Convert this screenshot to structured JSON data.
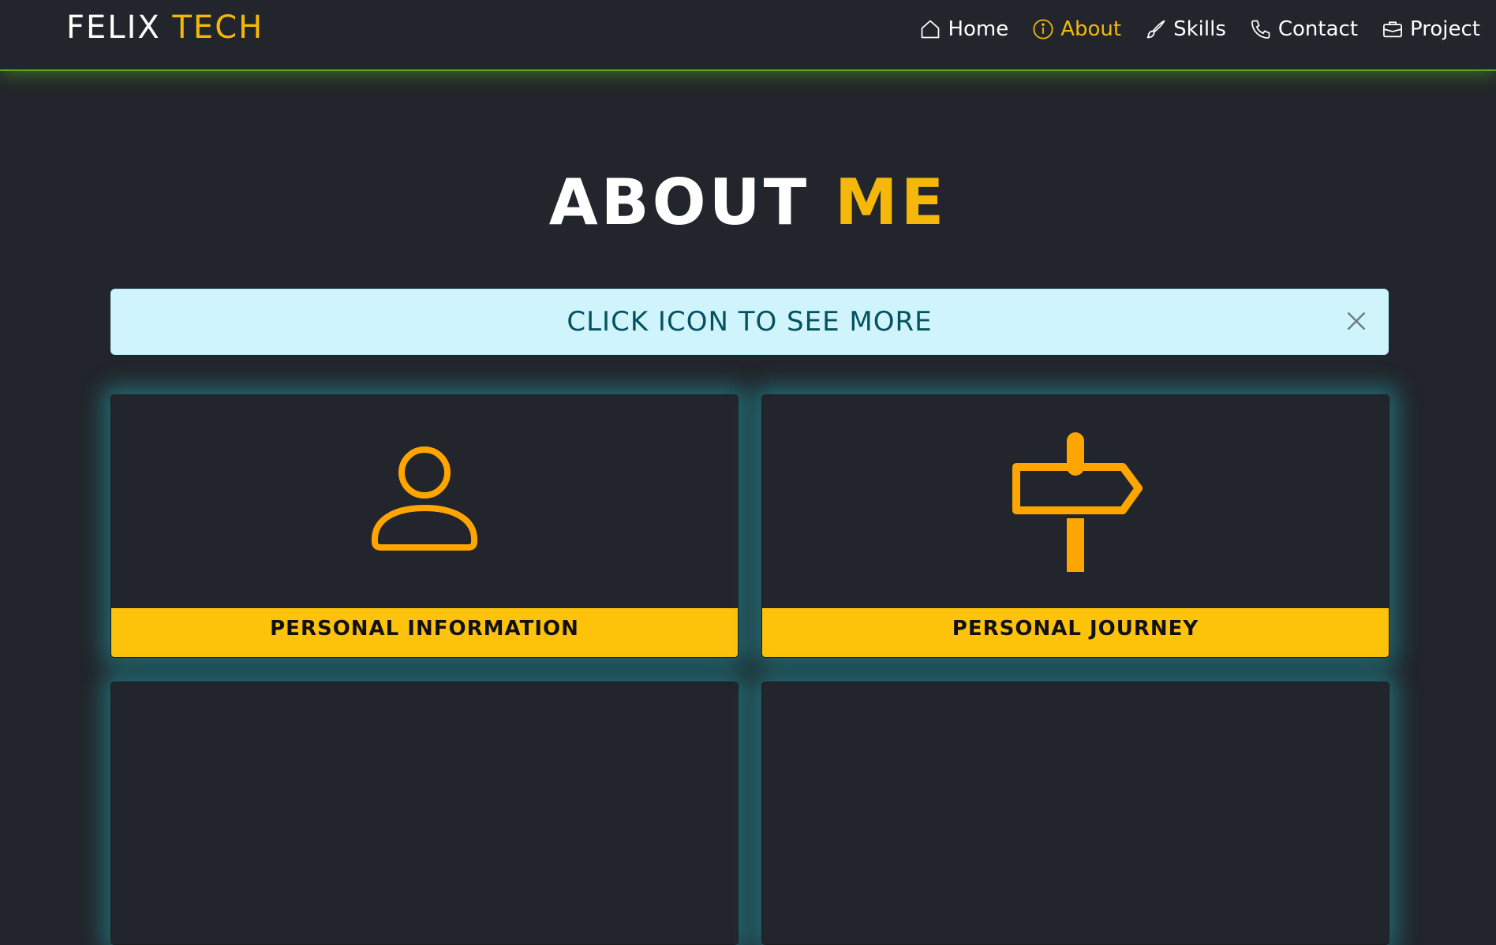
{
  "brand": {
    "name": "FELIX",
    "accent": "TECH"
  },
  "nav": {
    "items": [
      {
        "label": "Home",
        "icon": "home-icon"
      },
      {
        "label": "About",
        "icon": "info-icon",
        "active": true
      },
      {
        "label": "Skills",
        "icon": "brush-icon"
      },
      {
        "label": "Contact",
        "icon": "phone-icon"
      },
      {
        "label": "Project",
        "icon": "briefcase-icon"
      }
    ]
  },
  "heading": {
    "main": "ABOUT",
    "accent": "ME"
  },
  "alert": {
    "text": "CLICK ICON TO SEE MORE",
    "close_icon": "close-icon"
  },
  "cards": [
    {
      "title": "PERSONAL INFORMATION",
      "icon": "person-icon"
    },
    {
      "title": "PERSONAL JOURNEY",
      "icon": "signpost-icon"
    },
    {
      "title": "",
      "icon": ""
    },
    {
      "title": "",
      "icon": ""
    }
  ],
  "colors": {
    "background": "#22252b",
    "accent": "#f5b80a",
    "icon": "#ffa500",
    "nav_glow": "#58a51c",
    "card_glow": "#23a0aa",
    "alert_bg": "#cff4fc",
    "alert_text": "#055160",
    "card_footer": "#fdc30b"
  }
}
